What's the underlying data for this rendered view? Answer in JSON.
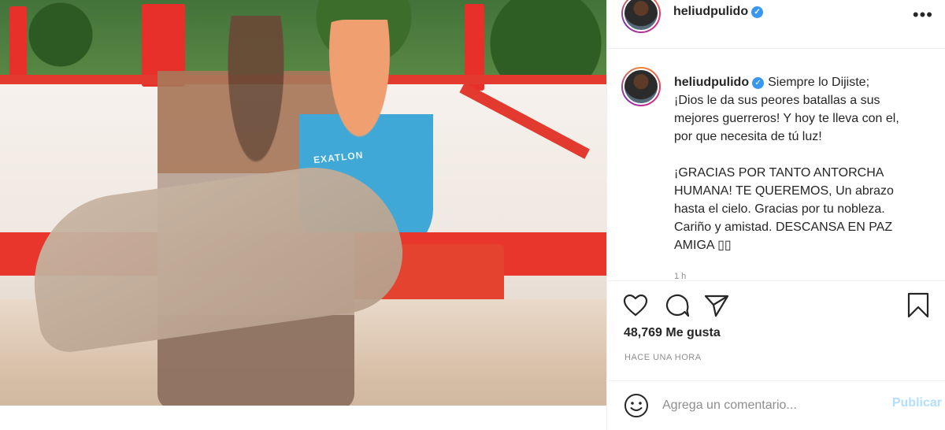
{
  "post": {
    "username": "heliudpulido",
    "verified_symbol": "✓",
    "more_symbol": "•••",
    "caption_user": "heliudpulido",
    "caption_text": "Siempre lo Dijiste;\n¡Dios le da sus peores batallas a sus mejores guerreros! Y hoy te lleva con el, por que necesita de tú luz!\n\n¡GRACIAS POR TANTO ANTORCHA HUMANA! TE QUEREMOS, Un abrazo hasta el cielo. Gracias por tu nobleza. Cariño y amistad. DESCANSA EN PAZ AMIGA ▯▯",
    "caption_more": "1 h",
    "likes": "48,769 Me gusta",
    "time_ago": "HACE UNA HORA",
    "comment_placeholder": "Agrega un comentario...",
    "publish_label": "Publicar",
    "photo_shirt_text": "EXATLON"
  },
  "icons": {
    "like": "heart-icon",
    "comment": "comment-bubble-icon",
    "share": "paper-plane-icon",
    "save": "bookmark-icon",
    "emoji": "smiley-icon",
    "verified": "verified-badge-icon",
    "more": "more-options-icon"
  },
  "colors": {
    "verified": "#3897f0",
    "publish_disabled": "#b2dffc",
    "secondary_text": "#8e8e8e",
    "divider": "#efefef"
  }
}
